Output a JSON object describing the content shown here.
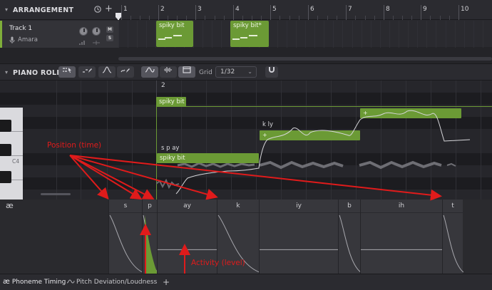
{
  "arrangement": {
    "title": "ARRANGEMENT",
    "add_label": "+",
    "ruler": [
      "1",
      "2",
      "3",
      "4",
      "5",
      "6",
      "7",
      "8",
      "9",
      "10"
    ]
  },
  "track": {
    "name": "Track 1",
    "voice": "Amara",
    "mute_label": "M",
    "solo_label": "S",
    "clips": [
      {
        "label": "spiky bit"
      },
      {
        "label": "spiky bit*"
      }
    ]
  },
  "piano_roll": {
    "title": "PIANO ROLL",
    "grid_label": "Grid",
    "grid_value": "1/32",
    "bar_number": "2",
    "key_label": "C4",
    "group_label": "spiky bit",
    "notes": [
      {
        "label": "spiky bit",
        "phonemes": "s p ay"
      },
      {
        "label": "",
        "phonemes": "k ly"
      },
      {
        "label": "",
        "phonemes": ""
      }
    ]
  },
  "phoneme_timing": {
    "icon_label": "æ",
    "phonemes": [
      "s",
      "p",
      "ay",
      "k",
      "iy",
      "b",
      "ih",
      "t"
    ],
    "activity_levels": [
      0.0,
      0.0,
      0.4,
      0.0,
      0.4,
      0.0,
      0.4,
      0.0
    ]
  },
  "tabs": {
    "phoneme_timing": "Phoneme Timing",
    "pitch": "Pitch Deviation/Loudness",
    "add": "+"
  },
  "annotations": {
    "position": "Position (time)",
    "activity": "Activity (level)"
  },
  "colors": {
    "accent_green": "#6b9a35",
    "annotation_red": "#e01b1b"
  }
}
